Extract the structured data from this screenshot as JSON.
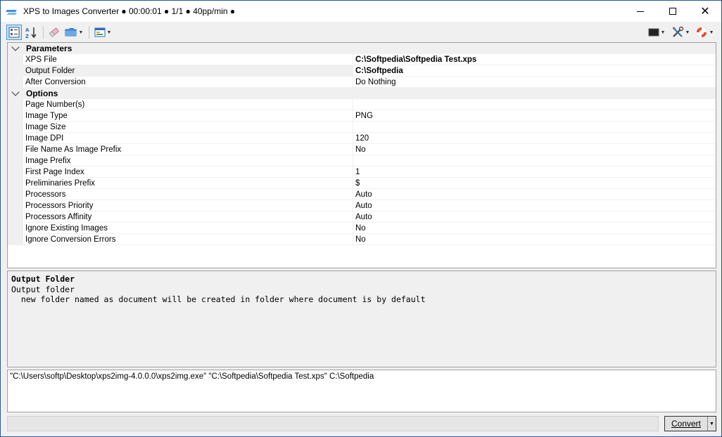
{
  "window": {
    "title": "XPS to Images Converter ● 00:00:01 ● 1/1 ● 40pp/min ●",
    "min_icon": "minimize-icon",
    "max_icon": "maximize-icon",
    "close_icon": "close-icon"
  },
  "toolbar": {
    "left_icons": [
      "categorized-icon",
      "sort-az-icon",
      "eraser-icon",
      "folder-icon",
      "view-icon"
    ],
    "right_icons": [
      "console-icon",
      "tools-icon",
      "help-lifebuoy-icon"
    ],
    "accent": "#3399ff"
  },
  "propgrid": {
    "categories": [
      {
        "label": "Parameters",
        "rows": [
          {
            "name": "XPS File",
            "value": "C:\\Softpedia\\Softpedia Test.xps",
            "bold": true
          },
          {
            "name": "Output Folder",
            "value": "C:\\Softpedia",
            "bold": true
          },
          {
            "name": "After Conversion",
            "value": "Do Nothing",
            "bold": false
          }
        ]
      },
      {
        "label": "Options",
        "rows": [
          {
            "name": "Page Number(s)",
            "value": "",
            "bold": false
          },
          {
            "name": "Image Type",
            "value": "PNG",
            "bold": false
          },
          {
            "name": "Image Size",
            "value": "",
            "bold": false
          },
          {
            "name": "Image DPI",
            "value": "120",
            "bold": false
          },
          {
            "name": "File Name As Image Prefix",
            "value": "No",
            "bold": false
          },
          {
            "name": "Image Prefix",
            "value": "",
            "bold": false
          },
          {
            "name": "First Page Index",
            "value": "1",
            "bold": false
          },
          {
            "name": "Preliminaries Prefix",
            "value": "$",
            "bold": false
          },
          {
            "name": "Processors",
            "value": "Auto",
            "bold": false
          },
          {
            "name": "Processors Priority",
            "value": "Auto",
            "bold": false
          },
          {
            "name": "Processors Affinity",
            "value": "Auto",
            "bold": false
          },
          {
            "name": "Ignore Existing Images",
            "value": "No",
            "bold": false
          },
          {
            "name": "Ignore Conversion Errors",
            "value": "No",
            "bold": false
          }
        ]
      }
    ]
  },
  "description": {
    "title": "Output Folder",
    "line1": "Output folder",
    "line2": "  new folder named as document will be created in folder where document is by default"
  },
  "command_line": "\"C:\\Users\\softp\\Desktop\\xps2img-4.0.0.0\\xps2img.exe\" \"C:\\Softpedia\\Softpedia Test.xps\" C:\\Softpedia",
  "convert_button": {
    "label": "Convert"
  }
}
